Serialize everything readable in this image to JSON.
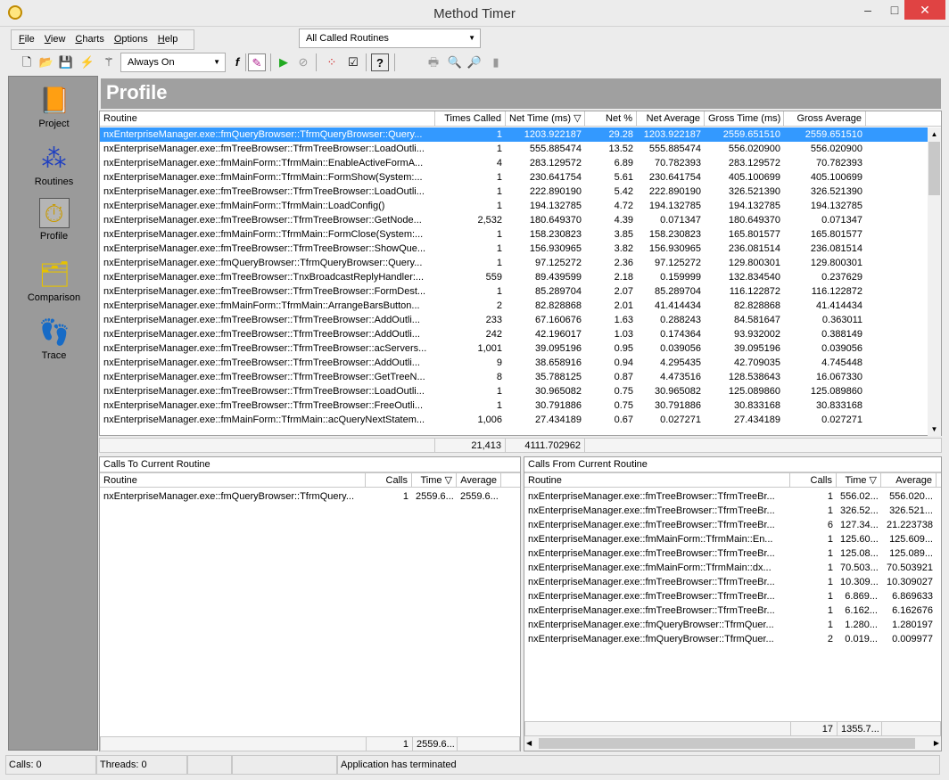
{
  "window": {
    "title": "Method Timer",
    "minimize": "–",
    "maximize": "□",
    "close": "✕",
    "app_icon": "stopwatch-icon"
  },
  "menu": {
    "items": [
      {
        "first": "F",
        "rest": "ile"
      },
      {
        "first": "V",
        "rest": "iew"
      },
      {
        "first": "C",
        "rest": "harts"
      },
      {
        "first": "O",
        "rest": "ptions"
      },
      {
        "first": "H",
        "rest": "elp"
      }
    ]
  },
  "filter": {
    "selected": "All Called Routines"
  },
  "toolbar": {
    "mode": "Always On",
    "icons": [
      "new-icon",
      "open-icon",
      "save-icon",
      "lightning-icon",
      "wand-icon",
      "function-icon",
      "marker-icon",
      "run-icon",
      "stop-icon",
      "colors-icon",
      "checklist-icon",
      "help-icon",
      "print-icon",
      "zoom-in-icon",
      "zoom-out-icon",
      "bar-icon"
    ]
  },
  "sidebar": {
    "items": [
      {
        "label": "Project",
        "icon": "book-icon"
      },
      {
        "label": "Routines",
        "icon": "routines-icon"
      },
      {
        "label": "Profile",
        "icon": "stopwatch-icon"
      },
      {
        "label": "Comparison",
        "icon": "folders-icon"
      },
      {
        "label": "Trace",
        "icon": "footprints-icon"
      }
    ]
  },
  "header": {
    "title": "Profile"
  },
  "profile": {
    "columns": [
      "Routine",
      "Times Called",
      "Net Time (ms) ▽",
      "Net %",
      "Net Average",
      "Gross Time (ms)",
      "Gross Average"
    ],
    "rows": [
      [
        "nxEnterpriseManager.exe::fmQueryBrowser::TfrmQueryBrowser::Query...",
        "1",
        "1203.922187",
        "29.28",
        "1203.922187",
        "2559.651510",
        "2559.651510"
      ],
      [
        "nxEnterpriseManager.exe::fmTreeBrowser::TfrmTreeBrowser::LoadOutli...",
        "1",
        "555.885474",
        "13.52",
        "555.885474",
        "556.020900",
        "556.020900"
      ],
      [
        "nxEnterpriseManager.exe::fmMainForm::TfrmMain::EnableActiveFormA...",
        "4",
        "283.129572",
        "6.89",
        "70.782393",
        "283.129572",
        "70.782393"
      ],
      [
        "nxEnterpriseManager.exe::fmMainForm::TfrmMain::FormShow(System:...",
        "1",
        "230.641754",
        "5.61",
        "230.641754",
        "405.100699",
        "405.100699"
      ],
      [
        "nxEnterpriseManager.exe::fmTreeBrowser::TfrmTreeBrowser::LoadOutli...",
        "1",
        "222.890190",
        "5.42",
        "222.890190",
        "326.521390",
        "326.521390"
      ],
      [
        "nxEnterpriseManager.exe::fmMainForm::TfrmMain::LoadConfig()",
        "1",
        "194.132785",
        "4.72",
        "194.132785",
        "194.132785",
        "194.132785"
      ],
      [
        "nxEnterpriseManager.exe::fmTreeBrowser::TfrmTreeBrowser::GetNode...",
        "2,532",
        "180.649370",
        "4.39",
        "0.071347",
        "180.649370",
        "0.071347"
      ],
      [
        "nxEnterpriseManager.exe::fmMainForm::TfrmMain::FormClose(System:...",
        "1",
        "158.230823",
        "3.85",
        "158.230823",
        "165.801577",
        "165.801577"
      ],
      [
        "nxEnterpriseManager.exe::fmTreeBrowser::TfrmTreeBrowser::ShowQue...",
        "1",
        "156.930965",
        "3.82",
        "156.930965",
        "236.081514",
        "236.081514"
      ],
      [
        "nxEnterpriseManager.exe::fmQueryBrowser::TfrmQueryBrowser::Query...",
        "1",
        "97.125272",
        "2.36",
        "97.125272",
        "129.800301",
        "129.800301"
      ],
      [
        "nxEnterpriseManager.exe::fmTreeBrowser::TnxBroadcastReplyHandler:...",
        "559",
        "89.439599",
        "2.18",
        "0.159999",
        "132.834540",
        "0.237629"
      ],
      [
        "nxEnterpriseManager.exe::fmTreeBrowser::TfrmTreeBrowser::FormDest...",
        "1",
        "85.289704",
        "2.07",
        "85.289704",
        "116.122872",
        "116.122872"
      ],
      [
        "nxEnterpriseManager.exe::fmMainForm::TfrmMain::ArrangeBarsButton...",
        "2",
        "82.828868",
        "2.01",
        "41.414434",
        "82.828868",
        "41.414434"
      ],
      [
        "nxEnterpriseManager.exe::fmTreeBrowser::TfrmTreeBrowser::AddOutli...",
        "233",
        "67.160676",
        "1.63",
        "0.288243",
        "84.581647",
        "0.363011"
      ],
      [
        "nxEnterpriseManager.exe::fmTreeBrowser::TfrmTreeBrowser::AddOutli...",
        "242",
        "42.196017",
        "1.03",
        "0.174364",
        "93.932002",
        "0.388149"
      ],
      [
        "nxEnterpriseManager.exe::fmTreeBrowser::TfrmTreeBrowser::acServers...",
        "1,001",
        "39.095196",
        "0.95",
        "0.039056",
        "39.095196",
        "0.039056"
      ],
      [
        "nxEnterpriseManager.exe::fmTreeBrowser::TfrmTreeBrowser::AddOutli...",
        "9",
        "38.658916",
        "0.94",
        "4.295435",
        "42.709035",
        "4.745448"
      ],
      [
        "nxEnterpriseManager.exe::fmTreeBrowser::TfrmTreeBrowser::GetTreeN...",
        "8",
        "35.788125",
        "0.87",
        "4.473516",
        "128.538643",
        "16.067330"
      ],
      [
        "nxEnterpriseManager.exe::fmTreeBrowser::TfrmTreeBrowser::LoadOutli...",
        "1",
        "30.965082",
        "0.75",
        "30.965082",
        "125.089860",
        "125.089860"
      ],
      [
        "nxEnterpriseManager.exe::fmTreeBrowser::TfrmTreeBrowser::FreeOutli...",
        "1",
        "30.791886",
        "0.75",
        "30.791886",
        "30.833168",
        "30.833168"
      ],
      [
        "nxEnterpriseManager.exe::fmMainForm::TfrmMain::acQueryNextStatem...",
        "1,006",
        "27.434189",
        "0.67",
        "0.027271",
        "27.434189",
        "0.027271"
      ]
    ],
    "footer": {
      "times_called": "21,413",
      "net_time": "4111.702962"
    }
  },
  "calls_to": {
    "title": "Calls To Current Routine",
    "columns": [
      "Routine",
      "Calls",
      "Time ▽",
      "Average"
    ],
    "rows": [
      [
        "nxEnterpriseManager.exe::fmQueryBrowser::TfrmQuery...",
        "1",
        "2559.6...",
        "2559.6..."
      ]
    ],
    "footer": {
      "calls": "1",
      "time": "2559.6..."
    }
  },
  "calls_from": {
    "title": "Calls From Current Routine",
    "columns": [
      "Routine",
      "Calls",
      "Time ▽",
      "Average"
    ],
    "rows": [
      [
        "nxEnterpriseManager.exe::fmTreeBrowser::TfrmTreeBr...",
        "1",
        "556.02...",
        "556.020..."
      ],
      [
        "nxEnterpriseManager.exe::fmTreeBrowser::TfrmTreeBr...",
        "1",
        "326.52...",
        "326.521..."
      ],
      [
        "nxEnterpriseManager.exe::fmTreeBrowser::TfrmTreeBr...",
        "6",
        "127.34...",
        "21.223738"
      ],
      [
        "nxEnterpriseManager.exe::fmMainForm::TfrmMain::En...",
        "1",
        "125.60...",
        "125.609..."
      ],
      [
        "nxEnterpriseManager.exe::fmTreeBrowser::TfrmTreeBr...",
        "1",
        "125.08...",
        "125.089..."
      ],
      [
        "nxEnterpriseManager.exe::fmMainForm::TfrmMain::dx...",
        "1",
        "70.503...",
        "70.503921"
      ],
      [
        "nxEnterpriseManager.exe::fmTreeBrowser::TfrmTreeBr...",
        "1",
        "10.309...",
        "10.309027"
      ],
      [
        "nxEnterpriseManager.exe::fmTreeBrowser::TfrmTreeBr...",
        "1",
        "6.869...",
        "6.869633"
      ],
      [
        "nxEnterpriseManager.exe::fmTreeBrowser::TfrmTreeBr...",
        "1",
        "6.162...",
        "6.162676"
      ],
      [
        "nxEnterpriseManager.exe::fmQueryBrowser::TfrmQuer...",
        "1",
        "1.280...",
        "1.280197"
      ],
      [
        "nxEnterpriseManager.exe::fmQueryBrowser::TfrmQuer...",
        "2",
        "0.019...",
        "0.009977"
      ]
    ],
    "footer": {
      "calls": "17",
      "time": "1355.7..."
    }
  },
  "status": {
    "calls": "Calls: 0",
    "threads": "Threads: 0",
    "message": "Application has terminated"
  }
}
